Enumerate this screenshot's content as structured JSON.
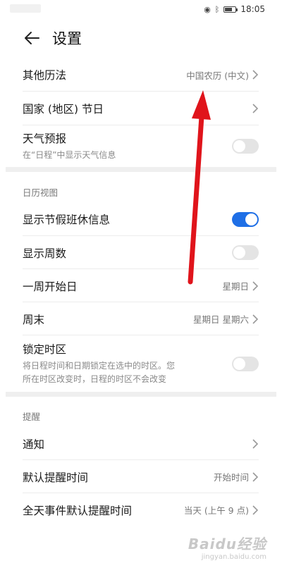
{
  "status_bar": {
    "icons": [
      "eye-icon",
      "bluetooth-icon",
      "battery-icon"
    ],
    "battery_level": 0.7,
    "time": "18:05"
  },
  "header": {
    "title": "设置"
  },
  "calendar_items": [
    {
      "label": "其他历法",
      "value": "中国农历 (中文)"
    },
    {
      "label": "国家 (地区) 节日"
    },
    {
      "label": "天气预报",
      "subtitle": "在“日程”中显示天气信息",
      "toggle": false
    }
  ],
  "calendar_view": {
    "header": "日历视图",
    "items": [
      {
        "label": "显示节假班休信息",
        "toggle": true
      },
      {
        "label": "显示周数",
        "toggle": false
      },
      {
        "label": "一周开始日",
        "value": "星期日"
      },
      {
        "label": "周末",
        "value": "星期日 星期六"
      },
      {
        "label": "锁定时区",
        "subtitle_line1": "将日程时间和日期锁定在选中的时区。您",
        "subtitle_line2": "所在时区改变时，日程的时区不会改变",
        "toggle": false
      }
    ]
  },
  "reminders": {
    "header": "提醒",
    "items": [
      {
        "label": "通知"
      },
      {
        "label": "默认提醒时间",
        "value": "开始时间"
      },
      {
        "label": "全天事件默认提醒时间",
        "value": "当天 (上午 9 点)"
      }
    ]
  },
  "watermark": {
    "logo": "Baidu经验",
    "url": "jingyan.baidu.com"
  },
  "colors": {
    "toggle_on": "#1f6fe6",
    "toggle_off": "#e4e4e4",
    "annotation_arrow": "#e0141b"
  }
}
